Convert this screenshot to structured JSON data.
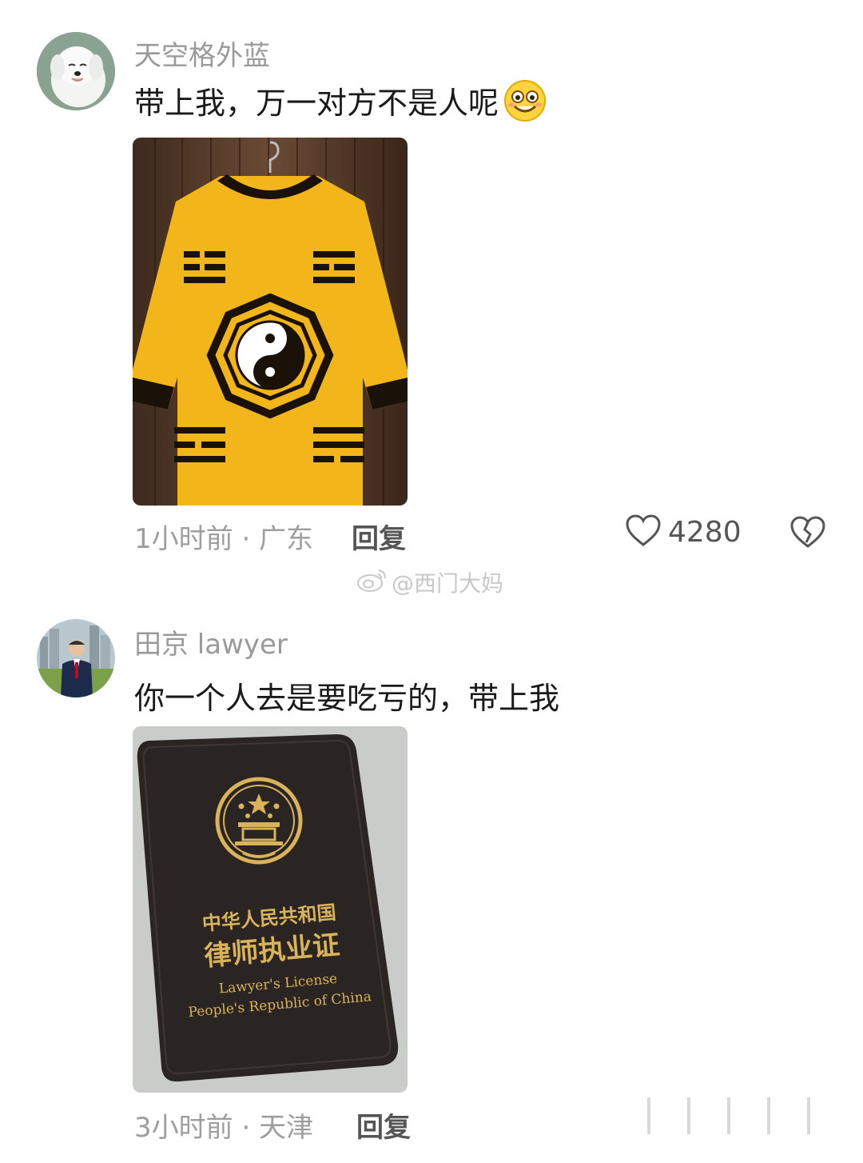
{
  "comments": [
    {
      "username": "天空格外蓝",
      "text": "带上我，万一对方不是人呢",
      "time_location": "1小时前 · 广东",
      "reply_label": "回复",
      "like_count": "4280"
    },
    {
      "username": "田京 lawyer",
      "text": "你一个人去是要吃亏的，带上我",
      "time_location": "3小时前 · 天津",
      "reply_label": "回复",
      "license": {
        "cn_line1": "中华人民共和国",
        "cn_line2": "律师执业证",
        "en_line1": "Lawyer's License",
        "en_line2": "People's Republic of China"
      }
    }
  ],
  "watermark": "@西门大妈",
  "colors": {
    "shirt_yellow": "#f2b51a",
    "wallet_black": "#2a2522",
    "gold": "#d9b35a"
  }
}
